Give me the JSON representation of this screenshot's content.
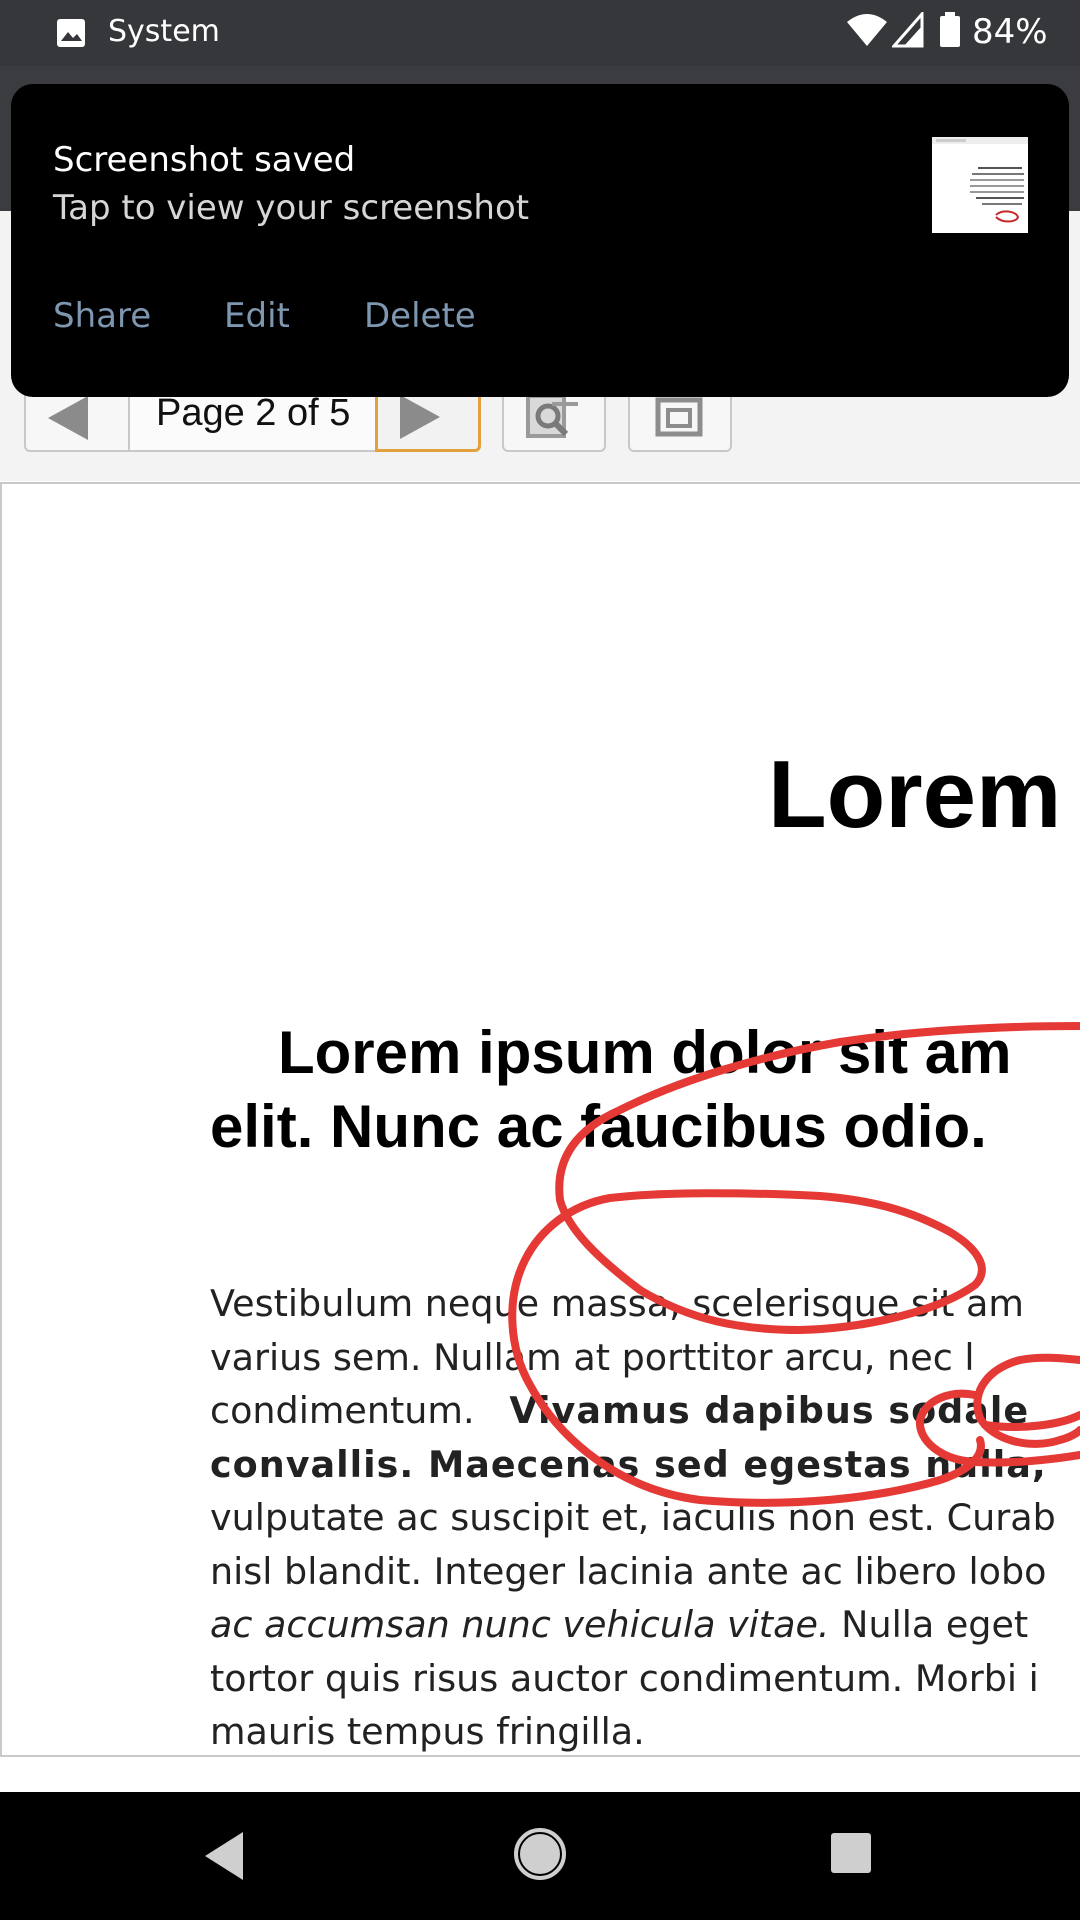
{
  "status_bar": {
    "app_label": "System",
    "battery_percent": "84%",
    "icons": [
      "image-icon",
      "wifi-icon",
      "signal-icon",
      "battery-icon"
    ]
  },
  "toolbar": {
    "page_indicator": "Page 2 of 5",
    "prev_icon": "triangle-left-icon",
    "next_icon": "triangle-right-icon",
    "search_icon": "find-icon",
    "fullscreen_icon": "window-icon",
    "accent_color": "#e2a13c"
  },
  "document": {
    "title": "Lorem",
    "heading_line1": "Lorem ipsum dolor sit am",
    "heading_line2": "elit. Nunc ac faucibus odio.",
    "body": {
      "l1": "Vestibulum neque massa, scelerisque sit am",
      "l2": "varius sem. Nullam at porttitor arcu, nec l",
      "l3a": "condimentum.",
      "l3b": "Vivamus dapibus sodale",
      "l4": "convallis. Maecenas sed egestas nulla,",
      "l5": "vulputate ac suscipit et, iaculis non est. Curab",
      "l6": "nisl blandit. Integer lacinia ante ac libero lobo",
      "l7a": "ac accumsan nunc vehicula vitae.",
      "l7b": " Nulla eget",
      "l8": "tortor quis risus auctor condimentum. Morbi i",
      "l9": "mauris tempus fringilla."
    },
    "annotation_color": "#e53935"
  },
  "notification": {
    "title": "Screenshot saved",
    "subtitle": "Tap to view your screenshot",
    "actions": {
      "share": "Share",
      "edit": "Edit",
      "delete": "Delete"
    },
    "action_color": "#7e97b0"
  },
  "nav_bar": {
    "icons": [
      "back-icon",
      "home-icon",
      "recents-icon"
    ]
  }
}
